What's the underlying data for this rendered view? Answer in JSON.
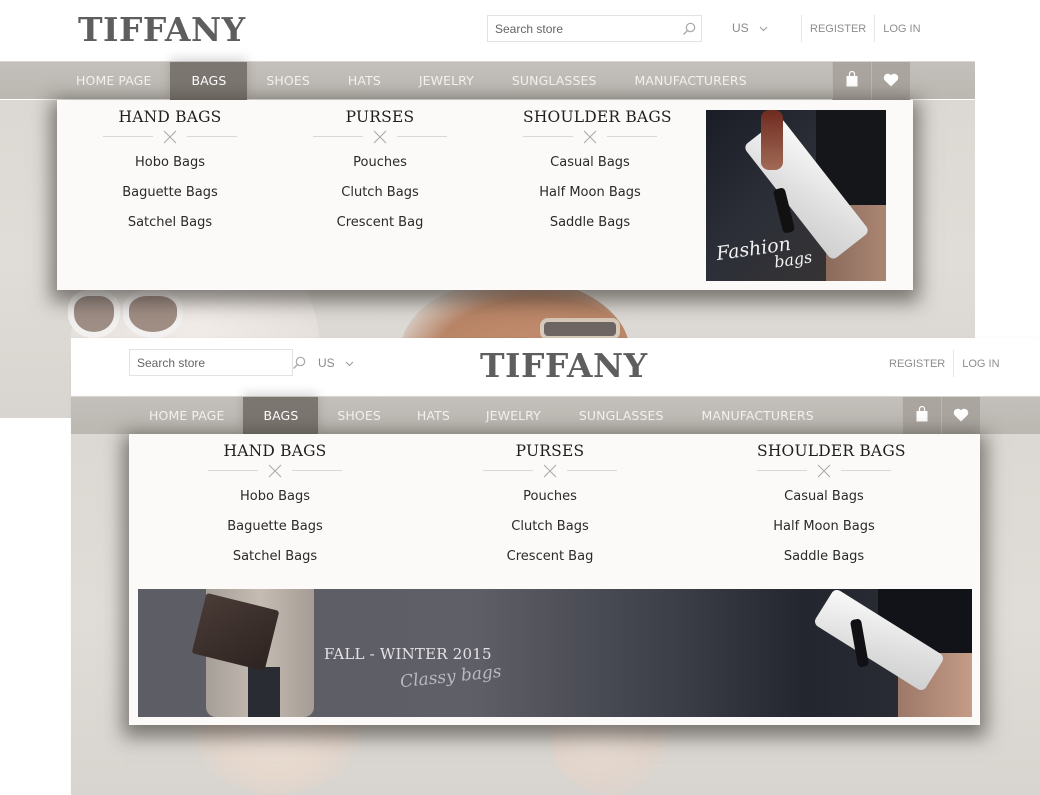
{
  "brand": {
    "logo": "TIFFANY"
  },
  "header": {
    "search_placeholder": "Search store",
    "language": "US",
    "register": "REGISTER",
    "login": "LOG IN"
  },
  "nav": {
    "items": [
      "HOME PAGE",
      "BAGS",
      "SHOES",
      "HATS",
      "JEWELRY",
      "SUNGLASSES",
      "MANUFACTURERS"
    ],
    "active": "BAGS",
    "icons": [
      "shopping-bag-icon",
      "heart-icon"
    ]
  },
  "dropdown": {
    "columns": [
      {
        "title": "HAND BAGS",
        "links": [
          "Hobo Bags",
          "Baguette Bags",
          "Satchel Bags"
        ]
      },
      {
        "title": "PURSES",
        "links": [
          "Pouches",
          "Clutch Bags",
          "Crescent Bag"
        ]
      },
      {
        "title": "SHOULDER BAGS",
        "links": [
          "Casual Bags",
          "Half Moon Bags",
          "Saddle Bags"
        ]
      }
    ],
    "promo_square": {
      "script_line1": "Fashion",
      "script_line2": "bags"
    },
    "banner": {
      "title": "FALL - WINTER 2015",
      "script": "Classy bags"
    }
  },
  "colors": {
    "nav_bg": "#bfbbb6",
    "nav_active": "#7c7670",
    "logo": "#5e5e5e",
    "dropdown_bg": "#fbfaf9"
  }
}
